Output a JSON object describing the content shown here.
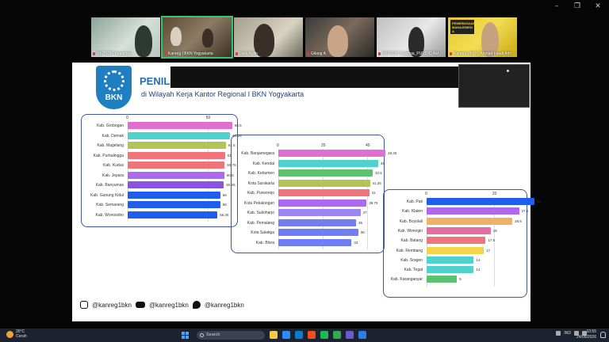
{
  "window": {
    "minimize": "–",
    "restore": "❐",
    "close": "✕"
  },
  "participants": [
    {
      "name": "BKPSDM Kebumen"
    },
    {
      "name": "Kanreg I BKN Yogyakarta"
    },
    {
      "name": "Deni Arifin"
    },
    {
      "name": "Gilang A"
    },
    {
      "name": "BKPSDM Salatiga_PURDIO AM"
    },
    {
      "name": "Kanreg I BKN_Ahmad Fuadi Adh"
    }
  ],
  "promo_text": "PEMERIKSAAN MANAJEMEN A",
  "slide": {
    "logo_text": "BKN",
    "title": "PENILA",
    "subtitle": "di Wilayah Kerja Kantor Regional I BKN Yogyakarta",
    "social": {
      "instagram": "@kanreg1bkn",
      "youtube": "@kanreg1bkn",
      "twitter": "@kanreg1bkn"
    }
  },
  "chart_data": [
    {
      "type": "bar",
      "orientation": "horizontal",
      "x_ticks": [
        0,
        50
      ],
      "xlim": [
        0,
        72
      ],
      "categories": [
        "Kab. Grobogan",
        "Kab. Demak",
        "Kab. Magelang",
        "Kab. Purbalingga",
        "Kab. Kudus",
        "Kab. Jepara",
        "Kab. Banyumas",
        "Kab. Gunung Kidul",
        "Kab. Semarang",
        "Kab. Wonosobo"
      ],
      "values": [
        65.5,
        64.25,
        61.5,
        61,
        60.75,
        60.5,
        60.25,
        58,
        58,
        56.25
      ],
      "value_labels": [
        "65.5",
        "64.25",
        "61.5",
        "61",
        "60.75",
        "60.5",
        "60.25",
        "58",
        "58",
        "56.25"
      ],
      "colors": [
        "#e26fcf",
        "#4fd1cd",
        "#b4c454",
        "#f0747a",
        "#f0737a",
        "#ad68f0",
        "#8b52e6",
        "#1f5cf0",
        "#1f5cf0",
        "#1f5cf0"
      ]
    },
    {
      "type": "bar",
      "orientation": "horizontal",
      "x_ticks": [
        0,
        20,
        40
      ],
      "xlim": [
        0,
        50
      ],
      "categories": [
        "Kab. Banjarnegara",
        "Kab. Kendal",
        "Kab. Kebumen",
        "Kota Surakarta",
        "Kab. Purworejo",
        "Kota Pekalongan",
        "Kab. Sukoharjo",
        "Kab. Pemalang",
        "Kota Salatiga",
        "Kab. Blora"
      ],
      "values": [
        48.25,
        45,
        42.5,
        41.25,
        41,
        39.75,
        37,
        35,
        36,
        33
      ],
      "value_labels": [
        "48.25",
        "45",
        "42.5",
        "41.25",
        "41",
        "39.75",
        "37",
        "35",
        "36",
        "33"
      ],
      "colors": [
        "#e26fcf",
        "#4fd1cd",
        "#5dc26f",
        "#b4c454",
        "#f0747a",
        "#ad68f0",
        "#9b86f2",
        "#6f7ef2",
        "#6f7ef2",
        "#6f7ef2"
      ]
    },
    {
      "type": "bar",
      "orientation": "horizontal",
      "x_ticks": [
        0,
        20
      ],
      "xlim": [
        0,
        33
      ],
      "categories": [
        "Kab. Pati",
        "Kab. Klaten",
        "Kab. Boyolali",
        "Kab. Wonogiri",
        "Kab. Batang",
        "Kab. Rembang",
        "Kab. Sragen",
        "Kab. Tegal",
        "Kab. Karanganyar"
      ],
      "values": [
        32,
        27.5,
        25.5,
        19,
        17.5,
        17,
        14,
        14,
        9
      ],
      "value_labels": [
        "32",
        "27.5",
        "25.5",
        "19",
        "17.5",
        "17",
        "14",
        "14",
        "9"
      ],
      "colors": [
        "#1f5cf0",
        "#ad68f0",
        "#f0b066",
        "#e26fa0",
        "#f0747a",
        "#f2d54a",
        "#4fd1cd",
        "#4fd1cd",
        "#5dc26f"
      ]
    }
  ],
  "taskbar": {
    "temperature": "26°C",
    "weather": "Cerah",
    "search_placeholder": "Search",
    "language": "IND",
    "time": "10:55",
    "date": "24/06/2026"
  }
}
